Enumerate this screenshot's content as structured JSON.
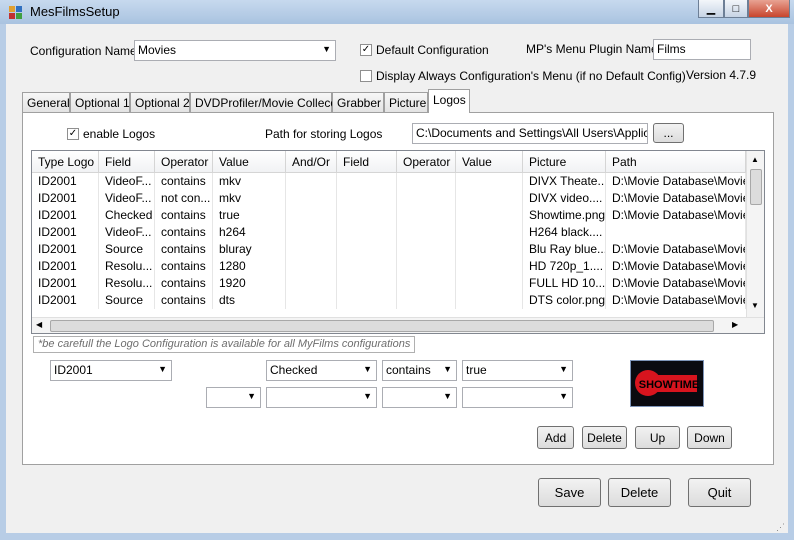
{
  "window": {
    "title": "MesFilmsSetup",
    "buttons": {
      "minimize": "▁",
      "maximize": "□",
      "close": "X"
    }
  },
  "config": {
    "name_label": "Configuration Name",
    "name_value": "Movies",
    "default_label": "Default Configuration",
    "default_checked": true,
    "display_always_label": "Display Always Configuration's Menu (if no Default Config)",
    "display_always_checked": false,
    "plugin_name_label": "MP's Menu Plugin Name",
    "plugin_name_value": "Films",
    "version": "Version 4.7.9"
  },
  "tabs": [
    "General",
    "Optional 1",
    "Optional 2",
    "DVDProfiler/Movie Collecor",
    "Grabber",
    "Picture",
    "Logos"
  ],
  "active_tab": "Logos",
  "logos": {
    "enable_label": "enable Logos",
    "enable_checked": true,
    "path_label": "Path for storing Logos",
    "path_value": "C:\\Documents and Settings\\All Users\\Applicatio",
    "browse_label": "...",
    "columns": [
      "Type Logo",
      "Field",
      "Operator",
      "Value",
      "And/Or",
      "Field",
      "Operator",
      "Value",
      "Picture",
      "Path"
    ],
    "rows": [
      [
        "ID2001",
        "VideoF...",
        "contains",
        "mkv",
        "",
        "",
        "",
        "",
        "DIVX Theate...",
        "D:\\Movie Database\\Movies"
      ],
      [
        "ID2001",
        "VideoF...",
        "not con...",
        "mkv",
        "",
        "",
        "",
        "",
        "DIVX video....",
        "D:\\Movie Database\\Movies"
      ],
      [
        "ID2001",
        "Checked",
        "contains",
        "true",
        "",
        "",
        "",
        "",
        "Showtime.png",
        "D:\\Movie Database\\Movies"
      ],
      [
        "ID2001",
        "VideoF...",
        "contains",
        "h264",
        "",
        "",
        "",
        "",
        "H264 black....",
        ""
      ],
      [
        "ID2001",
        "Source",
        "contains",
        "bluray",
        "",
        "",
        "",
        "",
        "Blu Ray blue...",
        "D:\\Movie Database\\Movies"
      ],
      [
        "ID2001",
        "Resolu...",
        "contains",
        "1280",
        "",
        "",
        "",
        "",
        "HD 720p_1....",
        "D:\\Movie Database\\Movies"
      ],
      [
        "ID2001",
        "Resolu...",
        "contains",
        "1920",
        "",
        "",
        "",
        "",
        "FULL HD 10...",
        "D:\\Movie Database\\Movies"
      ],
      [
        "ID2001",
        "Source",
        "contains",
        "dts",
        "",
        "",
        "",
        "",
        "DTS color.png",
        "D:\\Movie Database\\Movies"
      ]
    ],
    "note": "*be carefull the Logo Configuration is available for all MyFilms configurations",
    "editor": {
      "type_value": "ID2001",
      "field1_value": "Checked",
      "operator1_value": "contains",
      "value1_value": "true",
      "andor_value": "",
      "field2_value": "",
      "operator2_value": "",
      "value2_value": ""
    },
    "preview_text": "SHOWTIME",
    "buttons": {
      "add": "Add",
      "delete": "Delete",
      "up": "Up",
      "down": "Down"
    }
  },
  "footer": {
    "save": "Save",
    "delete": "Delete",
    "quit": "Quit"
  },
  "colors": {
    "accent": "#c7d9ee",
    "logo_red": "#d8141e"
  }
}
